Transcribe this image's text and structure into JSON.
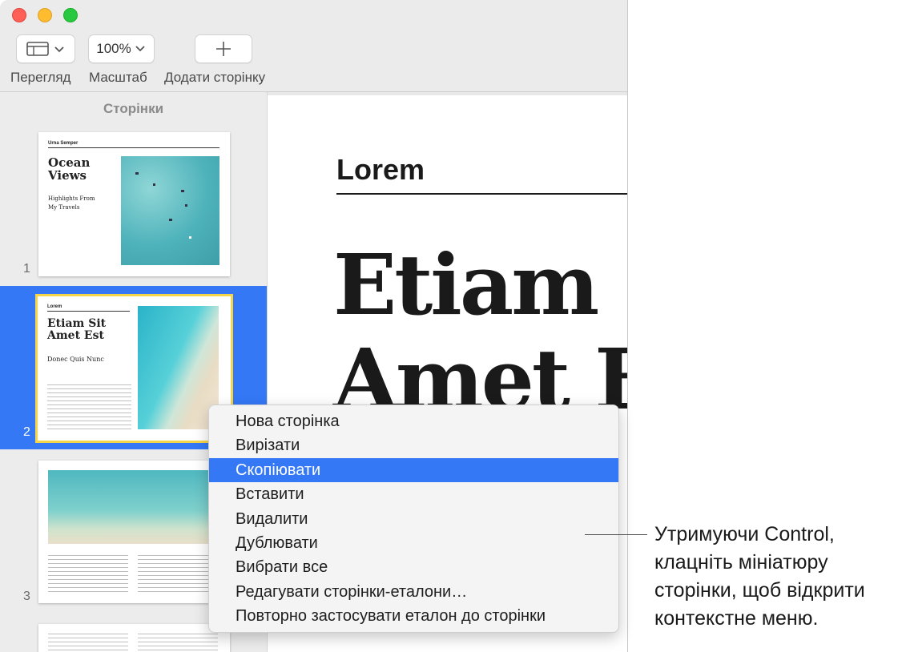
{
  "toolbar": {
    "view_label": "Перегляд",
    "zoom_value": "100%",
    "zoom_label": "Масштаб",
    "add_page_label": "Додати сторінку"
  },
  "sidebar": {
    "title": "Сторінки",
    "pages": [
      {
        "number": "1",
        "kicker": "Urna Semper",
        "title": "Ocean Views",
        "subtitle": "Highlights From My Travels"
      },
      {
        "number": "2",
        "kicker": "Lorem",
        "title": "Etiam Sit Amet Est",
        "subtitle": "Donec Quis Nunc"
      },
      {
        "number": "3"
      }
    ]
  },
  "document": {
    "heading": "Lorem",
    "title_line1": "Etiam S",
    "title_line2": "Amet E"
  },
  "context_menu": {
    "items": [
      "Нова сторінка",
      "Вирізати",
      "Скопіювати",
      "Вставити",
      "Видалити",
      "Дублювати",
      "Вибрати все",
      "Редагувати сторінки-еталони…",
      "Повторно застосувати еталон до сторінки"
    ],
    "highlighted_index": 2
  },
  "callout": {
    "line1": "Утримуючи Control,",
    "line2": "клацніть мініатюру",
    "line3": "сторінки, щоб відкрити",
    "line4": "контекстне меню."
  },
  "colors": {
    "accent": "#3478f6",
    "selection_outline": "#f7d54a"
  }
}
